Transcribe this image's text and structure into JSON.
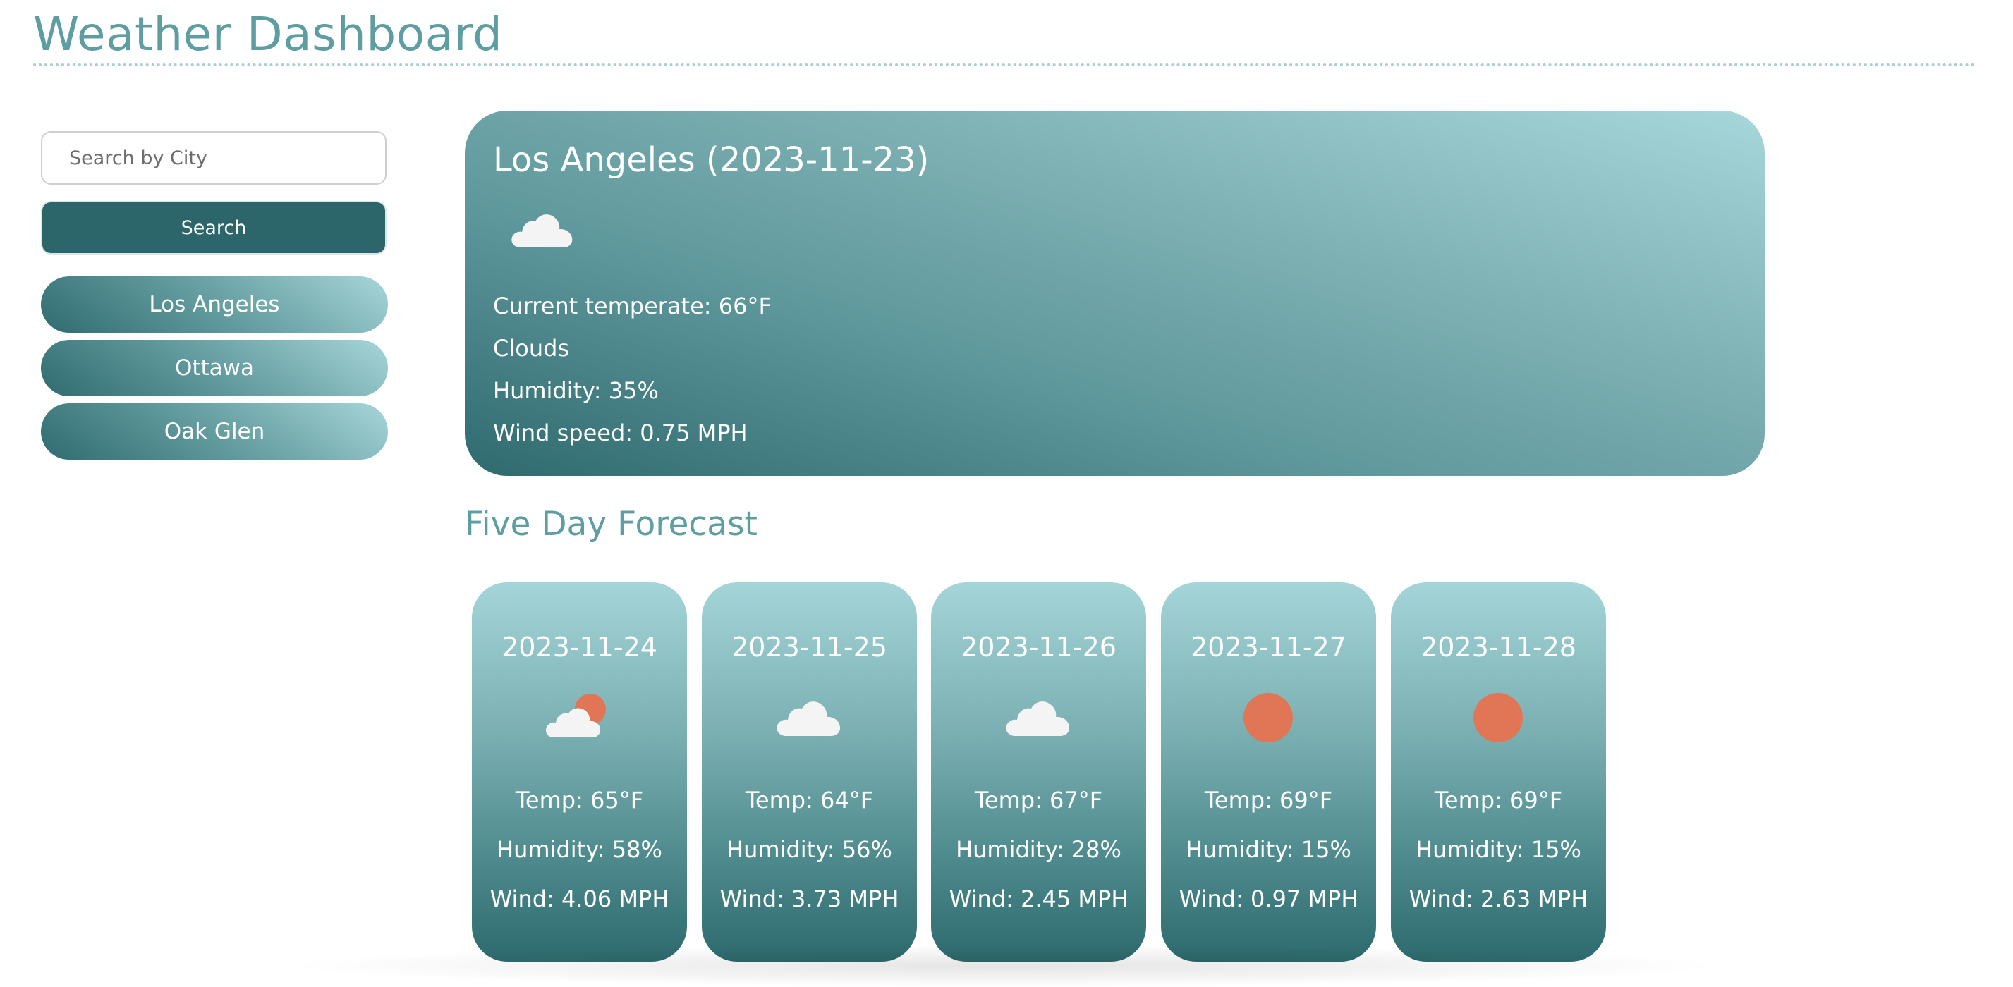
{
  "page": {
    "title": "Weather Dashboard"
  },
  "colors": {
    "accent": "#5e9ea2",
    "button_dark": "#2c666a",
    "card_dark": "#2f6a6e",
    "card_light": "#a6d7da",
    "sun": "#e07656"
  },
  "search": {
    "placeholder": "Search by City",
    "value": "",
    "button_label": "Search"
  },
  "history": [
    {
      "label": "Los Angeles"
    },
    {
      "label": "Ottawa"
    },
    {
      "label": "Oak Glen"
    }
  ],
  "current": {
    "title": "Los Angeles (2023-11-23)",
    "icon": "cloud-icon",
    "temperature": "Current temperate: 66°F",
    "condition": "Clouds",
    "humidity": "Humidity: 35%",
    "wind": "Wind speed: 0.75 MPH"
  },
  "forecast": {
    "heading": "Five Day Forecast",
    "days": [
      {
        "date": "2023-11-24",
        "icon": "partly-cloudy-icon",
        "temp": "Temp: 65°F",
        "humidity": "Humidity: 58%",
        "wind": "Wind: 4.06 MPH"
      },
      {
        "date": "2023-11-25",
        "icon": "cloud-icon",
        "temp": "Temp: 64°F",
        "humidity": "Humidity: 56%",
        "wind": "Wind: 3.73 MPH"
      },
      {
        "date": "2023-11-26",
        "icon": "cloud-icon",
        "temp": "Temp: 67°F",
        "humidity": "Humidity: 28%",
        "wind": "Wind: 2.45 MPH"
      },
      {
        "date": "2023-11-27",
        "icon": "sun-icon",
        "temp": "Temp: 69°F",
        "humidity": "Humidity: 15%",
        "wind": "Wind: 0.97 MPH"
      },
      {
        "date": "2023-11-28",
        "icon": "sun-icon",
        "temp": "Temp: 69°F",
        "humidity": "Humidity: 15%",
        "wind": "Wind: 2.63 MPH"
      }
    ]
  }
}
